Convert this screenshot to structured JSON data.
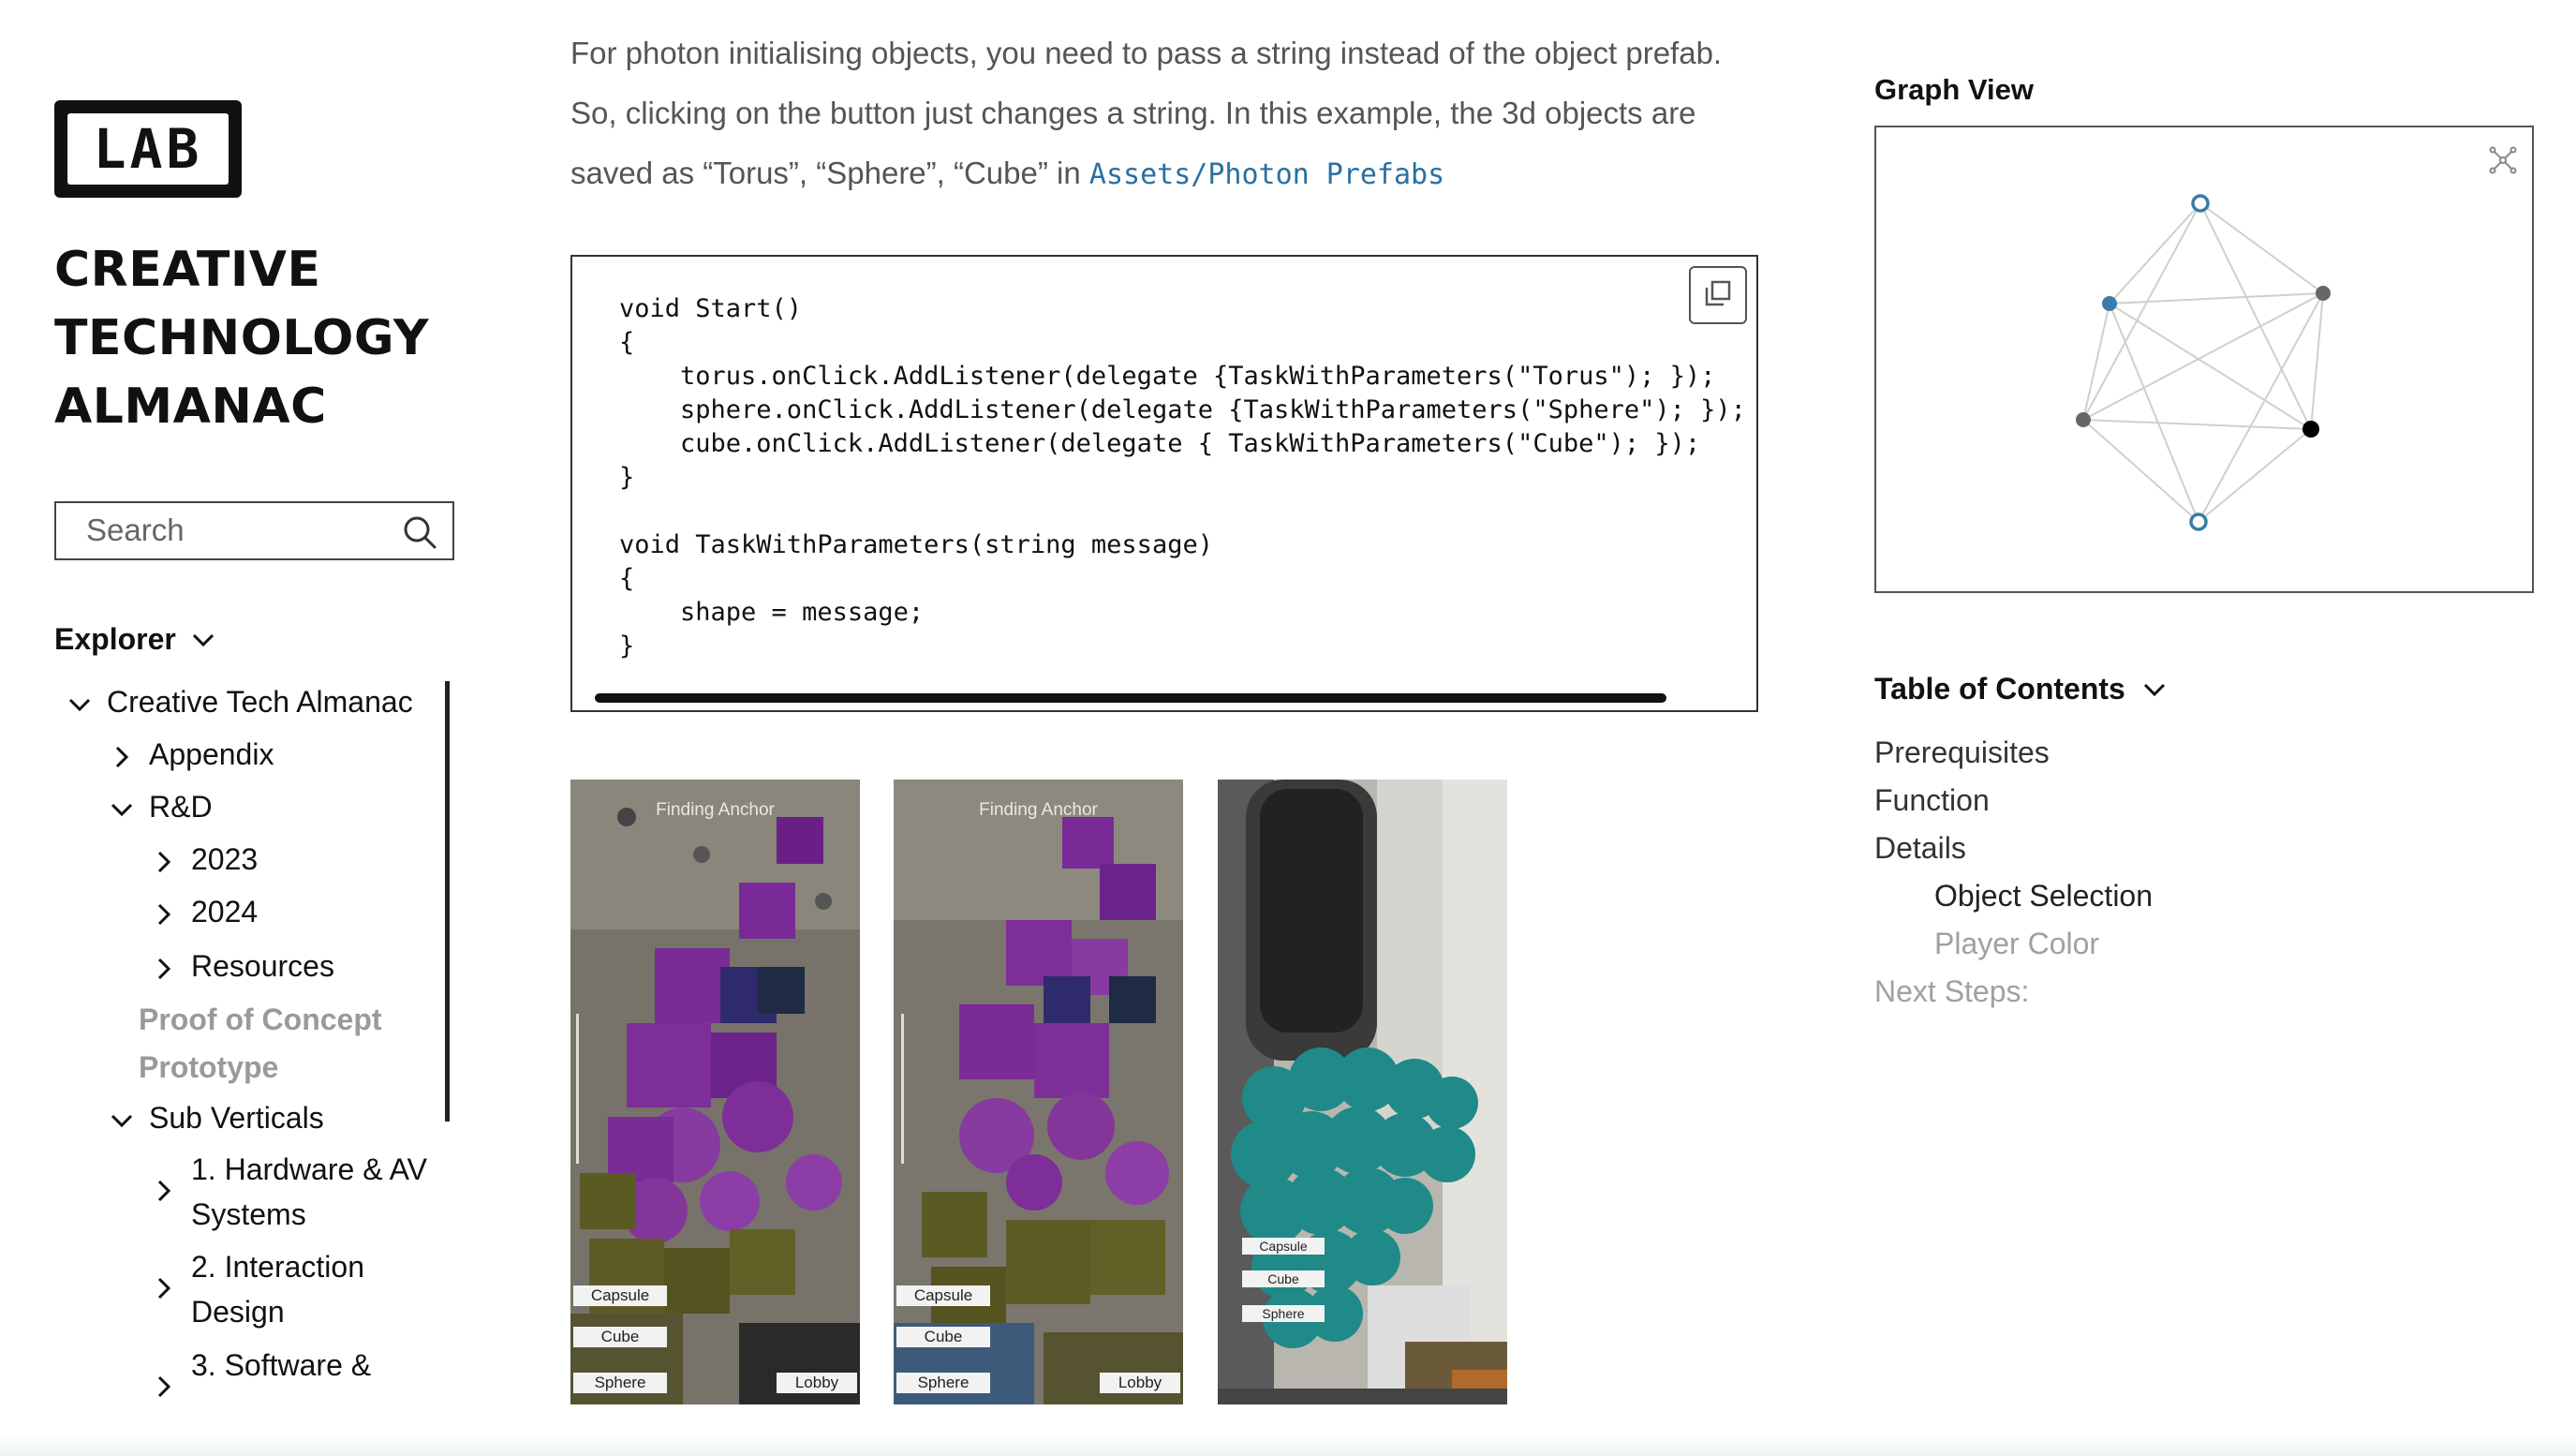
{
  "brand": {
    "logo_text": "LAB",
    "title_lines": [
      "CREATIVE",
      "TECHNOLOGY",
      "ALMANAC"
    ]
  },
  "search": {
    "placeholder": "Search"
  },
  "explorer": {
    "heading": "Explorer",
    "tree": [
      {
        "label": "Creative Tech Almanac",
        "state": "expanded"
      },
      {
        "label": "Appendix",
        "state": "collapsed"
      },
      {
        "label": "R&D",
        "state": "expanded"
      },
      {
        "label": "2023",
        "state": "collapsed"
      },
      {
        "label": "2024",
        "state": "collapsed"
      },
      {
        "label": "Resources",
        "state": "collapsed"
      },
      {
        "label": "Proof of Concept",
        "state": "leaf"
      },
      {
        "label": "Prototype",
        "state": "leaf"
      },
      {
        "label": "Sub Verticals",
        "state": "expanded"
      },
      {
        "label": "1. Hardware & AV Systems",
        "state": "collapsed"
      },
      {
        "label": "2. Interaction Design",
        "state": "collapsed"
      },
      {
        "label": "3. Software &",
        "state": "collapsed"
      }
    ]
  },
  "article": {
    "lines": [
      {
        "text": "For photon initialising objects, you need to pass a string instead of the object prefab."
      },
      {
        "text": "So, clicking on the button just changes a string. In this example, the 3d objects are"
      },
      {
        "text": "saved as “Torus”, “Sphere”, “Cube” in ",
        "code": "Assets/Photon Prefabs"
      }
    ],
    "code": "void Start()\n{\n    torus.onClick.AddListener(delegate {TaskWithParameters(\"Torus\"); });\n    sphere.onClick.AddListener(delegate {TaskWithParameters(\"Sphere\"); });\n    cube.onClick.AddListener(delegate { TaskWithParameters(\"Cube\"); });\n}\n\nvoid TaskWithParameters(string message)\n{\n    shape = message;\n}",
    "screenshots": [
      {
        "top_label": "Finding Anchor",
        "buttons": [
          "Capsule",
          "Cube",
          "Sphere",
          "Lobby"
        ]
      },
      {
        "top_label": "Finding Anchor",
        "buttons": [
          "Capsule",
          "Cube",
          "Sphere",
          "Lobby"
        ]
      },
      {
        "top_label": "",
        "buttons": [
          "Capsule",
          "Cube",
          "Sphere"
        ]
      }
    ]
  },
  "graph": {
    "title": "Graph View",
    "nodes": [
      {
        "id": "n1",
        "style": "hollow-blue"
      },
      {
        "id": "n2",
        "style": "filled-blue"
      },
      {
        "id": "n3",
        "style": "filled-gray"
      },
      {
        "id": "n4",
        "style": "filled-gray"
      },
      {
        "id": "n5",
        "style": "filled-black"
      },
      {
        "id": "n6",
        "style": "hollow-blue"
      }
    ]
  },
  "toc": {
    "heading": "Table of Contents",
    "items": [
      {
        "label": "Prerequisites",
        "level": 1,
        "state": "normal"
      },
      {
        "label": "Function",
        "level": 1,
        "state": "normal"
      },
      {
        "label": "Details",
        "level": 1,
        "state": "normal"
      },
      {
        "label": "Object Selection",
        "level": 2,
        "state": "active"
      },
      {
        "label": "Player Color",
        "level": 2,
        "state": "muted"
      },
      {
        "label": "Next Steps:",
        "level": 1,
        "state": "muted"
      }
    ]
  },
  "colors": {
    "link_code": "#2a6fa0",
    "node_blue": "#3a7ca5",
    "node_gray": "#666666",
    "text_muted": "#9a9a9a"
  }
}
